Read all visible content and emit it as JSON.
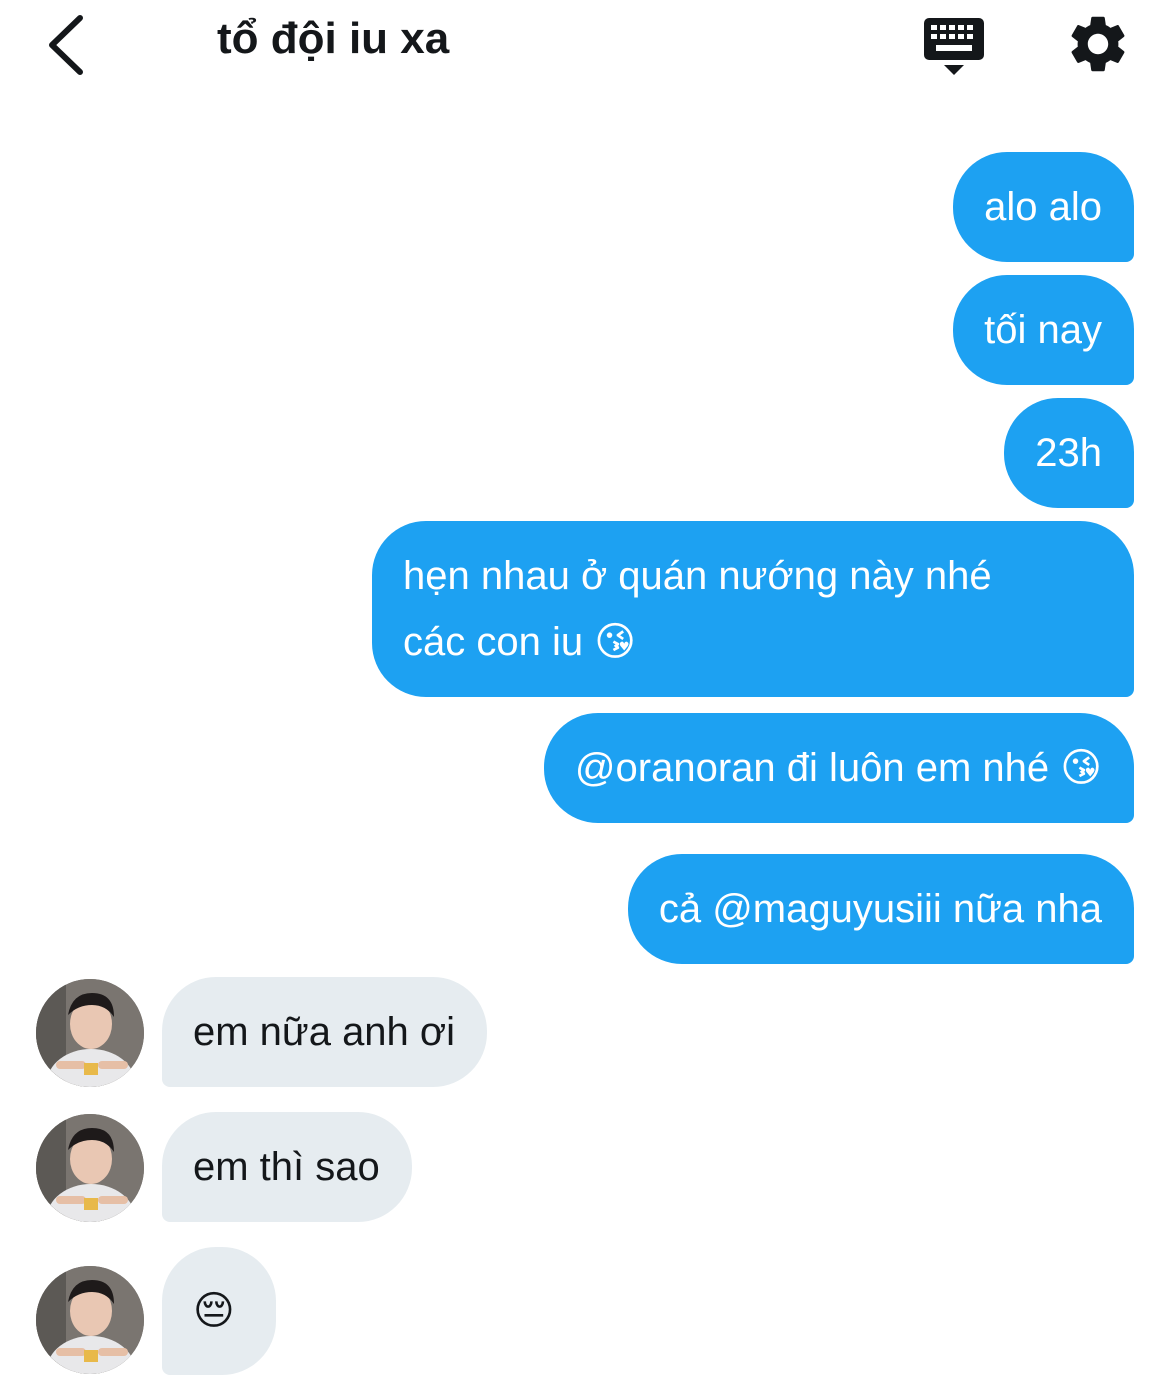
{
  "header": {
    "title": "tổ đội iu xa",
    "icons": {
      "back": "chevron-left-icon",
      "keyboard": "keyboard-icon",
      "settings": "gear-icon"
    }
  },
  "messages": [
    {
      "direction": "sent",
      "text": "alo alo"
    },
    {
      "direction": "sent",
      "text": "tối nay"
    },
    {
      "direction": "sent",
      "text": "23h"
    },
    {
      "direction": "sent",
      "line1": "hẹn nhau ở quán nướng này nhé",
      "line2": "các con iu",
      "emoji": "😘"
    },
    {
      "direction": "sent",
      "text": "@oranoran đi luôn em nhé",
      "emoji": "😘"
    },
    {
      "direction": "sent",
      "text": "cả @maguyusiii nữa nha"
    },
    {
      "direction": "received",
      "text": "em nữa anh ơi"
    },
    {
      "direction": "received",
      "text": "em thì sao"
    },
    {
      "direction": "received",
      "emoji": "😔"
    }
  ],
  "colors": {
    "sent_bubble": "#1da1f2",
    "received_bubble": "#e6ecf0",
    "text_dark": "#14171a"
  }
}
